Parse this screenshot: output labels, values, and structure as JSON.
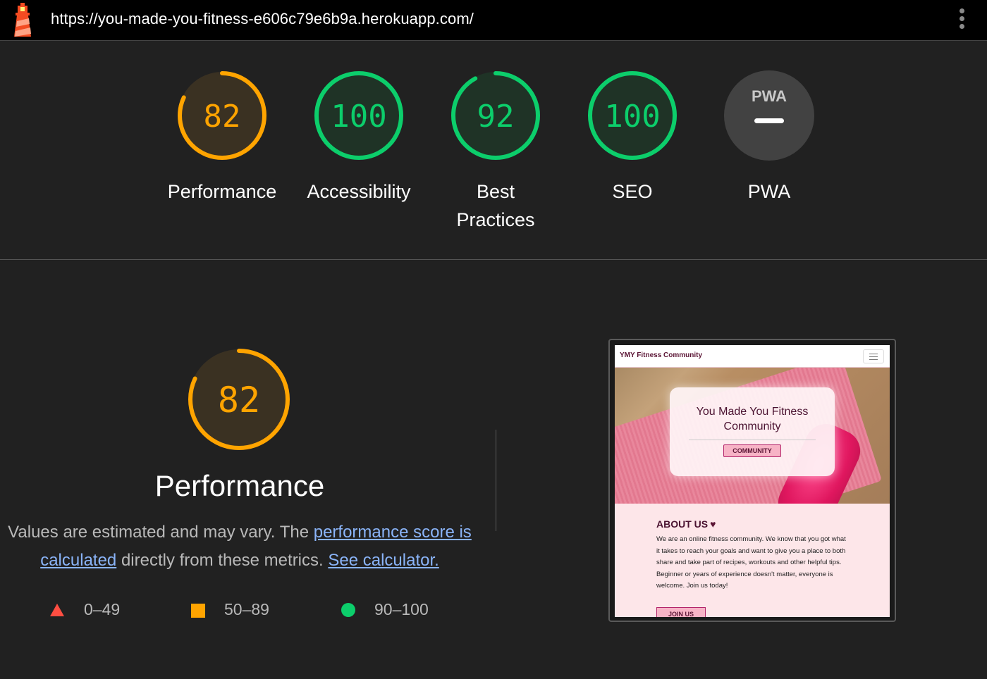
{
  "topbar": {
    "url": "https://you-made-you-fitness-e606c79e6b9a.herokuapp.com/",
    "logo_icon": "lighthouse-icon",
    "menu_icon": "kebab-menu-icon"
  },
  "colors": {
    "average": "#ffa400",
    "pass": "#0cce6b",
    "fail": "#ff4e42",
    "neutral": "#5f5f5f"
  },
  "gauges": [
    {
      "label": "Performance",
      "score": "82",
      "status": "average"
    },
    {
      "label": "Accessibility",
      "score": "100",
      "status": "pass"
    },
    {
      "label_line1": "Best",
      "label_line2": "Practices",
      "score": "92",
      "status": "pass"
    },
    {
      "label": "SEO",
      "score": "100",
      "status": "pass"
    },
    {
      "label": "PWA",
      "badge": "PWA",
      "status": "na"
    }
  ],
  "performance": {
    "score": "82",
    "title": "Performance",
    "desc_prefix": "Values are estimated and may vary. The ",
    "link1": "performance score is calculated",
    "desc_middle": " directly from these metrics. ",
    "link2": "See calculator."
  },
  "legend": [
    {
      "shape": "triangle",
      "range": "0–49"
    },
    {
      "shape": "square",
      "range": "50–89"
    },
    {
      "shape": "circle",
      "range": "90–100"
    }
  ],
  "thumbnail": {
    "brand": "YMY Fitness Community",
    "hero_title": "You Made You Fitness Community",
    "hero_button": "COMMUNITY",
    "about_heading": "ABOUT US",
    "about_text": "We are an online fitness community. We know that you got what it takes to reach your goals and want to give you a place to both share and take part of recipes, workouts and other helpful tips. Beginner or years of experience doesn't matter, everyone is welcome. Join us today!",
    "join_button": "JOIN US"
  }
}
